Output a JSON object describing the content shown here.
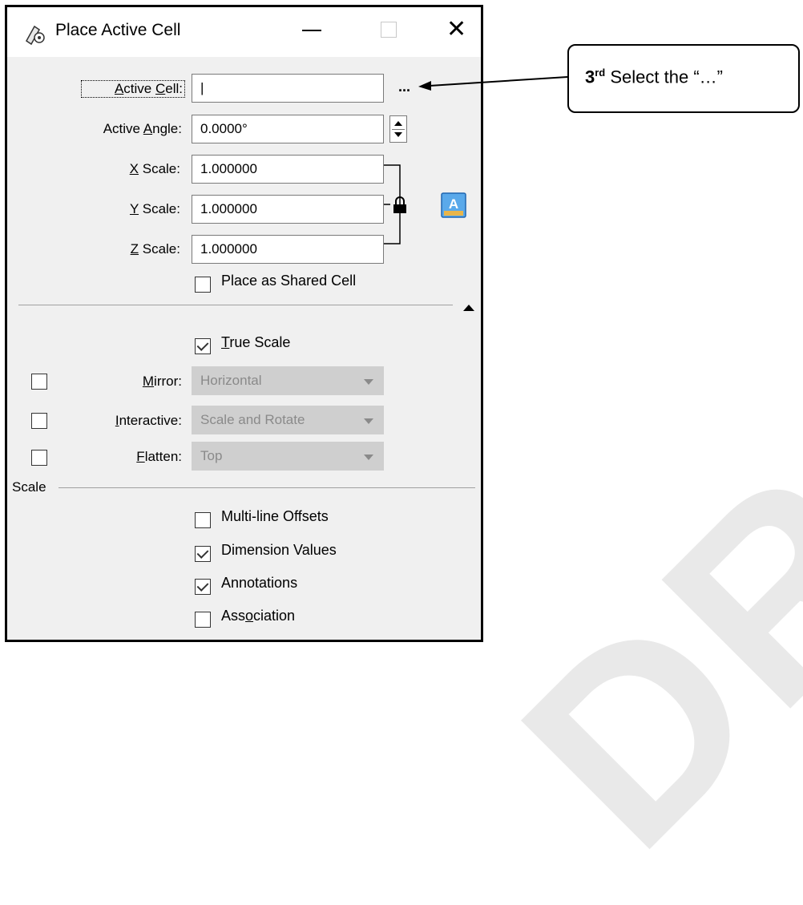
{
  "window": {
    "title": "Place Active Cell"
  },
  "labels": {
    "active_cell": "Active Cell:",
    "active_angle": "Active Angle:",
    "x_scale": "X Scale:",
    "y_scale": "Y Scale:",
    "z_scale": "Z Scale:",
    "mirror": "Mirror:",
    "interactive": "Interactive:",
    "flatten": "Flatten:",
    "scale_section": "Scale"
  },
  "fields": {
    "active_cell": "|",
    "browse": "...",
    "active_angle": "0.0000°",
    "x_scale": "1.000000",
    "y_scale": "1.000000",
    "z_scale": "1.000000",
    "mirror": "Horizontal",
    "interactive": "Scale and Rotate",
    "flatten": "Top"
  },
  "checkboxes": {
    "shared_cell": {
      "label": "Place as Shared Cell",
      "checked": false
    },
    "true_scale": {
      "label": "True Scale",
      "checked": true
    },
    "mirror": {
      "checked": false
    },
    "interactive": {
      "checked": false
    },
    "flatten": {
      "checked": false
    },
    "multiline_offsets": {
      "label": "Multi-line Offsets",
      "checked": false
    },
    "dimension_values": {
      "label": "Dimension Values",
      "checked": true
    },
    "annotations": {
      "label": "Annotations",
      "checked": true
    },
    "association": {
      "label": "Association",
      "checked": false
    }
  },
  "callout": {
    "num": "3",
    "sup": "rd",
    "text": " Select the “…”"
  },
  "watermark": "DRAFT",
  "colors": {
    "accent_icon": "#3a8fd8",
    "disabled_field": "#cfcfcf"
  }
}
